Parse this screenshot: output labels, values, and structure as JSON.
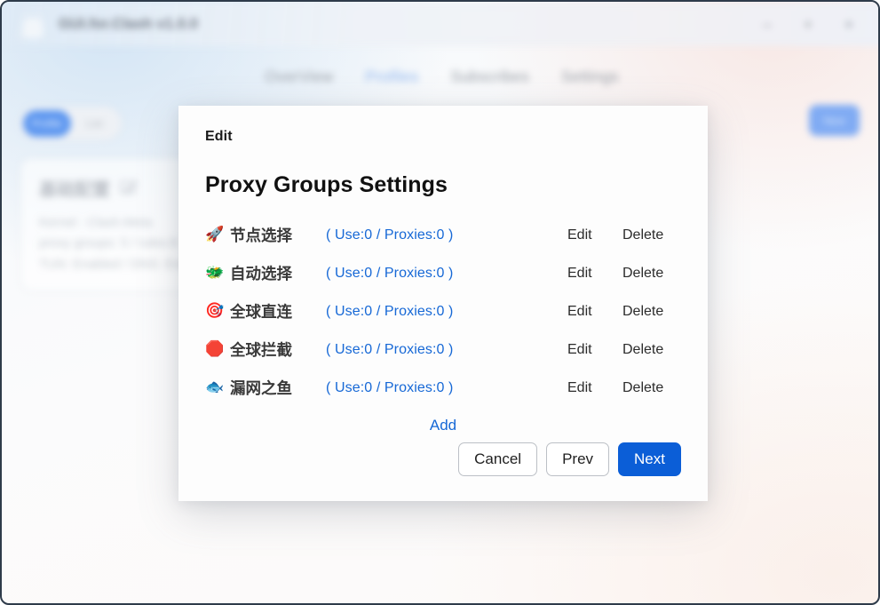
{
  "window": {
    "title": "GUI.for.Clash v1.0.0",
    "logo_icon": "cat-logo-icon",
    "controls": {
      "minimize": "–",
      "maximize": "+",
      "close": "×"
    }
  },
  "nav": {
    "tabs": [
      {
        "label": "OverView",
        "active": false
      },
      {
        "label": "Profiles",
        "active": true
      },
      {
        "label": "Subscribes",
        "active": false
      },
      {
        "label": "Settings",
        "active": false
      }
    ]
  },
  "background": {
    "toggle": {
      "left_label": "Profile",
      "right_label": "List"
    },
    "action_button_label": "New",
    "profile_card": {
      "title": "基础配置",
      "edit_icon": "edit-square-icon",
      "meta_lines": [
        "Kernel : Clash.Meta",
        "proxy groups: 5 / rules:8",
        "TUN: Enabled / DNS: Enabled"
      ]
    }
  },
  "modal": {
    "kicker": "Edit",
    "title": "Proxy Groups Settings",
    "columns": {
      "edit": "Edit",
      "delete": "Delete"
    },
    "groups": [
      {
        "emoji": "🚀",
        "emoji_name": "rocket-icon",
        "name": "节点选择",
        "count": "( Use:0 / Proxies:0 )",
        "edit": "Edit",
        "delete": "Delete"
      },
      {
        "emoji": "🐲",
        "emoji_name": "dragon-face-icon",
        "name": "自动选择",
        "count": "( Use:0 / Proxies:0 )",
        "edit": "Edit",
        "delete": "Delete"
      },
      {
        "emoji": "🎯",
        "emoji_name": "direct-hit-icon",
        "name": "全球直连",
        "count": "( Use:0 / Proxies:0 )",
        "edit": "Edit",
        "delete": "Delete"
      },
      {
        "emoji": "🛑",
        "emoji_name": "stop-sign-icon",
        "name": "全球拦截",
        "count": "( Use:0 / Proxies:0 )",
        "edit": "Edit",
        "delete": "Delete"
      },
      {
        "emoji": "🐟",
        "emoji_name": "fish-icon",
        "name": "漏网之鱼",
        "count": "( Use:0 / Proxies:0 )",
        "edit": "Edit",
        "delete": "Delete"
      }
    ],
    "add_label": "Add",
    "footer": {
      "cancel": "Cancel",
      "prev": "Prev",
      "next": "Next"
    }
  },
  "colors": {
    "accent_blue": "#1668d6",
    "primary_button": "#0b5ed7",
    "active_tab": "#93b8f0",
    "muted_text": "#9aa0a8"
  }
}
